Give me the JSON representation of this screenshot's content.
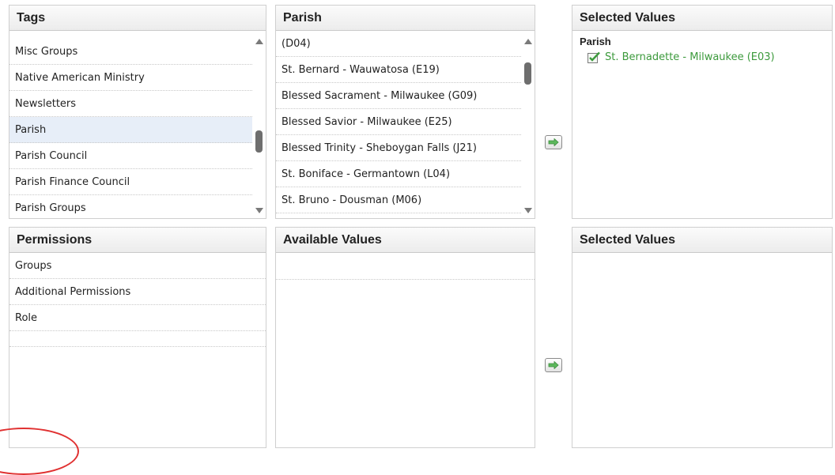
{
  "tags": {
    "header": "Tags",
    "items": [
      "Misc Groups",
      "Native American Ministry",
      "Newsletters",
      "Parish",
      "Parish Council",
      "Parish Finance Council",
      "Parish Groups"
    ],
    "selected": "Parish"
  },
  "parish": {
    "header": "Parish",
    "items": [
      "(D04)",
      "St. Bernard - Wauwatosa (E19)",
      "Blessed Sacrament - Milwaukee (G09)",
      "Blessed Savior - Milwaukee (E25)",
      "Blessed Trinity - Sheboygan Falls (J21)",
      "St. Boniface - Germantown (L04)",
      "St. Bruno - Dousman (M06)"
    ]
  },
  "selected_top": {
    "header": "Selected Values",
    "group_label": "Parish",
    "value": "St. Bernadette - Milwaukee (E03)",
    "value_color": "#3c9a3c"
  },
  "permissions": {
    "header": "Permissions",
    "items": [
      "Groups",
      "Additional Permissions",
      "Role"
    ]
  },
  "available": {
    "header": "Available Values"
  },
  "selected_bottom": {
    "header": "Selected Values"
  },
  "icons": {
    "move_right": "arrow-right-icon",
    "check": "checkbox-checked-icon"
  },
  "colors": {
    "header_bg": "#ececec",
    "selected_row_bg": "#e7eef8",
    "button_arrow": "#5cb85c",
    "annotation_circle": "#e03131"
  }
}
